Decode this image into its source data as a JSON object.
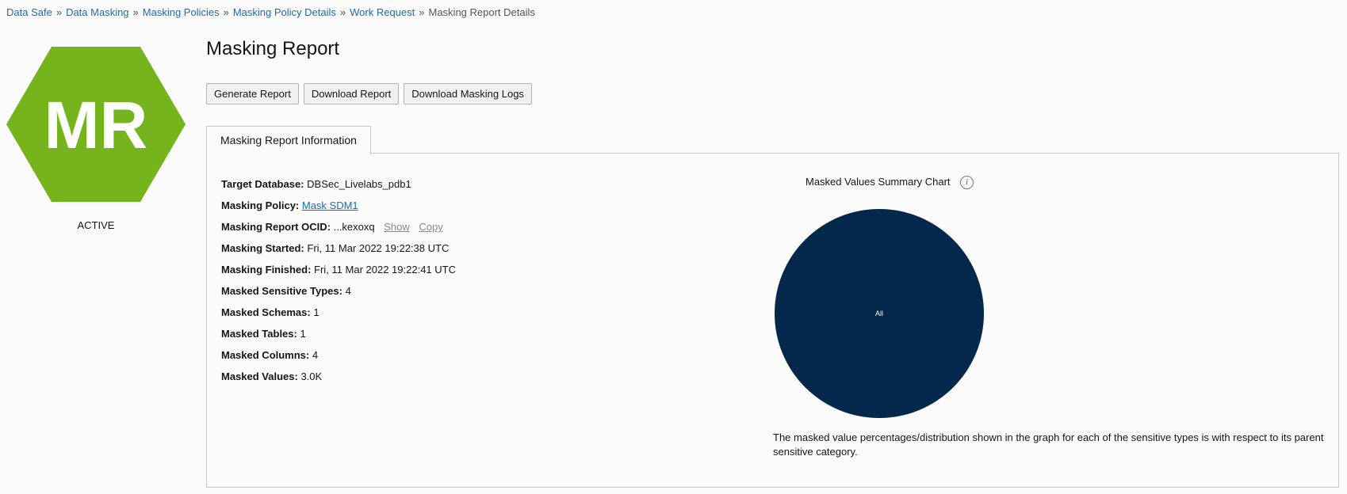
{
  "breadcrumb": {
    "items": [
      "Data Safe",
      "Data Masking",
      "Masking Policies",
      "Masking Policy Details",
      "Work Request"
    ],
    "current": "Masking Report Details",
    "separator": "»"
  },
  "badge": {
    "initials": "MR",
    "status": "ACTIVE",
    "color": "#76b41d"
  },
  "page_title": "Masking Report",
  "actions": {
    "generate": "Generate Report",
    "download": "Download Report",
    "logs": "Download Masking Logs"
  },
  "tab_label": "Masking Report Information",
  "info": {
    "target_db_label": "Target Database:",
    "target_db_value": "DBSec_Livelabs_pdb1",
    "policy_label": "Masking Policy:",
    "policy_value": "Mask SDM1",
    "ocid_label": "Masking Report OCID:",
    "ocid_value": "...kexoxq",
    "ocid_show": "Show",
    "ocid_copy": "Copy",
    "started_label": "Masking Started:",
    "started_value": "Fri, 11 Mar 2022 19:22:38 UTC",
    "finished_label": "Masking Finished:",
    "finished_value": "Fri, 11 Mar 2022 19:22:41 UTC",
    "types_label": "Masked Sensitive Types:",
    "types_value": "4",
    "schemas_label": "Masked Schemas:",
    "schemas_value": "1",
    "tables_label": "Masked Tables:",
    "tables_value": "1",
    "columns_label": "Masked Columns:",
    "columns_value": "4",
    "values_label": "Masked Values:",
    "values_value": "3.0K"
  },
  "chart_title": "Masked Values Summary Chart",
  "chart_note": "The masked value percentages/distribution shown in the graph for each of the sensitive types is with respect to its parent sensitive category.",
  "chart_data": {
    "type": "pie",
    "title": "Masked Values Summary Chart",
    "categories": [
      "All"
    ],
    "values": [
      100
    ],
    "colors": [
      "#04284c"
    ]
  }
}
